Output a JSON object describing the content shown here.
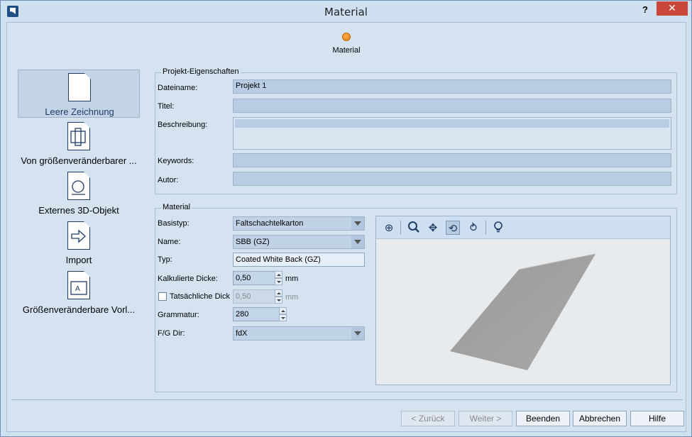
{
  "window": {
    "title": "Material",
    "help": "?",
    "close": "✕"
  },
  "step": {
    "label": "Material",
    "color": "#f08a1c"
  },
  "left_items": [
    {
      "label": "Leere Zeichnung",
      "icon": "blank-document-icon",
      "selected": true
    },
    {
      "label": "Von größenveränderbarer ...",
      "icon": "resizable-box-document-icon"
    },
    {
      "label": "Externes 3D-Objekt",
      "icon": "external-3d-object-icon"
    },
    {
      "label": "Import",
      "icon": "import-arrow-icon"
    },
    {
      "label": "Größenveränderbare Vorl...",
      "icon": "resizable-template-icon"
    }
  ],
  "project": {
    "title": "Projekt-Eigenschaften",
    "dateiname_label": "Dateiname:",
    "dateiname_value": "Projekt 1",
    "titel_label": "Titel:",
    "titel_value": "",
    "beschreibung_label": "Beschreibung:",
    "beschreibung_value": "",
    "keywords_label": "Keywords:",
    "keywords_value": "",
    "autor_label": "Autor:",
    "autor_value": ""
  },
  "material": {
    "title": "Material",
    "basistyp_label": "Basistyp:",
    "basistyp_value": "Faltschachtelkarton",
    "name_label": "Name:",
    "name_value": "SBB (GZ)",
    "typ_label": "Typ:",
    "typ_value": "Coated White Back (GZ)",
    "kalk_label": "Kalkulierte Dicke:",
    "kalk_value": "0,50",
    "kalk_unit": "mm",
    "tats_label": "Tatsächliche Dick",
    "tats_value": "0,50",
    "tats_unit": "mm",
    "tats_checked": false,
    "grammatur_label": "Grammatur:",
    "grammatur_value": "280",
    "fg_label": "F/G Dir:",
    "fg_value": "fdX"
  },
  "viewer_tools": [
    "zoom-fit-icon",
    "zoom-icon",
    "pan-icon",
    "rotate-icon",
    "spin-icon",
    "light-icon"
  ],
  "buttons": {
    "back": "< Zurück",
    "next": "Weiter >",
    "finish": "Beenden",
    "cancel": "Abbrechen",
    "help": "Hilfe"
  }
}
